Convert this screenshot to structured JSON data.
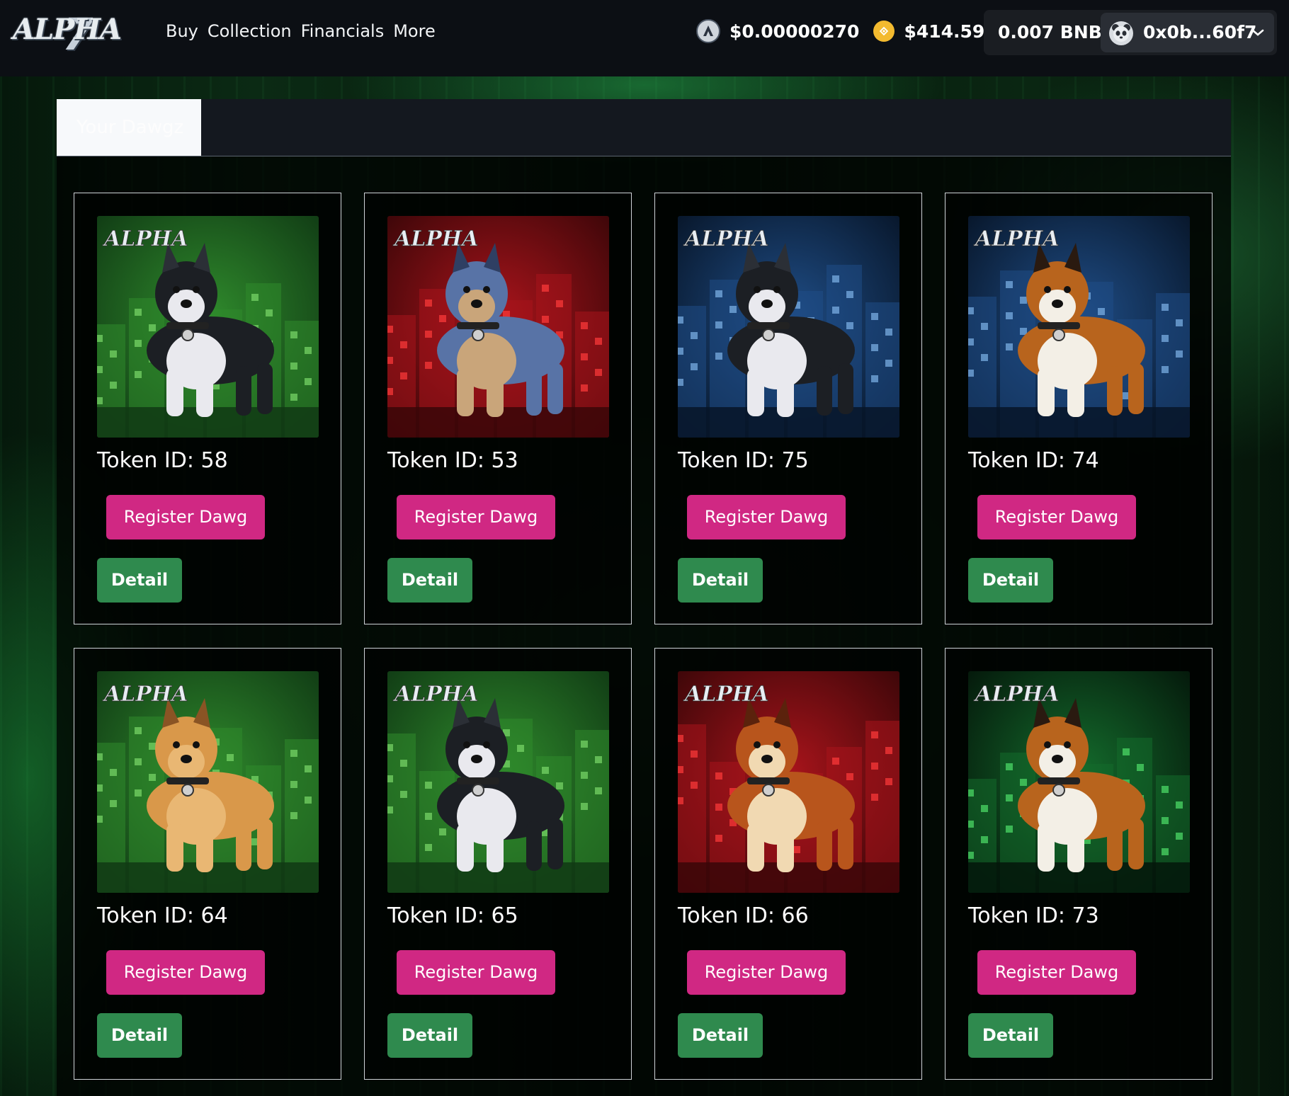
{
  "brand": {
    "logo_text": "ALPHA",
    "logo_numeral": "7"
  },
  "nav": [
    "Buy",
    "Collection",
    "Financials",
    "More"
  ],
  "prices": {
    "alpha_price": "$0.00000270",
    "bnb_price": "$414.59",
    "alpha_icon": "alpha7-token-icon",
    "bnb_icon": "bnb-token-icon"
  },
  "wallet": {
    "balance": "0.007 BNB",
    "address": "0x0b...60f7"
  },
  "tabs": [
    {
      "label": "Your Dawgz",
      "active": true
    }
  ],
  "buttons": {
    "register": "Register Dawg",
    "detail": "Detail"
  },
  "cards": [
    {
      "token": "Token ID: 58",
      "breed": "husky",
      "scene": "green"
    },
    {
      "token": "Token ID: 53",
      "breed": "heeler",
      "scene": "red"
    },
    {
      "token": "Token ID: 75",
      "breed": "husky",
      "scene": "blue"
    },
    {
      "token": "Token ID: 74",
      "breed": "beagle",
      "scene": "blue"
    },
    {
      "token": "Token ID: 64",
      "breed": "sharpei",
      "scene": "green"
    },
    {
      "token": "Token ID: 65",
      "breed": "husky",
      "scene": "green"
    },
    {
      "token": "Token ID: 66",
      "breed": "bulldog",
      "scene": "red"
    },
    {
      "token": "Token ID: 73",
      "breed": "beagle",
      "scene": "darkgreen"
    }
  ],
  "colors": {
    "register": "#d02883",
    "detail": "#2f8a4e",
    "header": "#0c0f14",
    "scene_green": [
      "#103a14",
      "#2f8a2c",
      "#7bd86a"
    ],
    "scene_red": [
      "#3a0608",
      "#a8141b",
      "#ff3b3b"
    ],
    "scene_blue": [
      "#071528",
      "#1f4d86",
      "#7fb3e8"
    ],
    "scene_darkgreen": [
      "#04160a",
      "#146b2c",
      "#4fe06a"
    ]
  }
}
